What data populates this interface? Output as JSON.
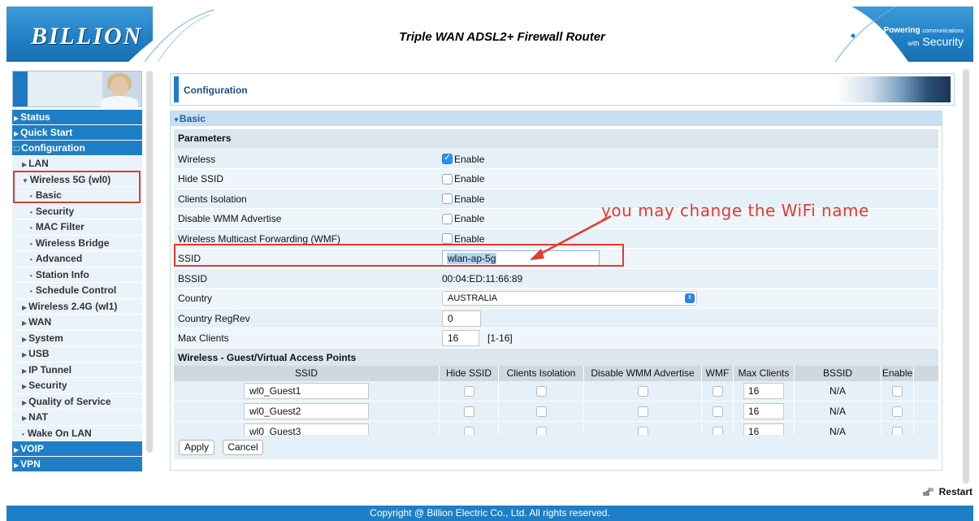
{
  "header": {
    "logo": "BILLION",
    "title": "Triple WAN ADSL2+ Firewall Router",
    "power_line1": "Powering",
    "power_line1_small": "communications",
    "power_line2_small": "with",
    "power_line2": "Security"
  },
  "sidebar": {
    "top_items": [
      {
        "label": "Status"
      },
      {
        "label": "Quick Start"
      },
      {
        "label": "Configuration"
      }
    ],
    "config_items": [
      {
        "label": "LAN"
      },
      {
        "label": "Wireless 5G (wl0)"
      },
      {
        "label": "Basic"
      },
      {
        "label": "Security"
      },
      {
        "label": "MAC Filter"
      },
      {
        "label": "Wireless Bridge"
      },
      {
        "label": "Advanced"
      },
      {
        "label": "Station Info"
      },
      {
        "label": "Schedule Control"
      },
      {
        "label": "Wireless 2.4G (wl1)"
      },
      {
        "label": "WAN"
      },
      {
        "label": "System"
      },
      {
        "label": "USB"
      },
      {
        "label": "IP Tunnel"
      },
      {
        "label": "Security"
      },
      {
        "label": "Quality of Service"
      },
      {
        "label": "NAT"
      },
      {
        "label": "Wake On LAN"
      }
    ],
    "bottom_items": [
      {
        "label": "VOIP"
      },
      {
        "label": "VPN"
      }
    ]
  },
  "main": {
    "page_title": "Configuration",
    "section_title": "Basic",
    "params_header": "Parameters",
    "enable_label": "Enable",
    "rows": {
      "wireless": {
        "label": "Wireless",
        "checked": true
      },
      "hide_ssid": {
        "label": "Hide SSID",
        "checked": false
      },
      "clients_isolation": {
        "label": "Clients Isolation",
        "checked": false
      },
      "disable_wmm": {
        "label": "Disable WMM Advertise",
        "checked": false
      },
      "wmf": {
        "label": "Wireless Multicast Forwarding (WMF)",
        "checked": false
      },
      "ssid": {
        "label": "SSID",
        "value": "wlan-ap-5g"
      },
      "bssid": {
        "label": "BSSID",
        "value": "00:04:ED:11:66:89"
      },
      "country": {
        "label": "Country",
        "value": "AUSTRALIA"
      },
      "country_regrev": {
        "label": "Country RegRev",
        "value": "0"
      },
      "max_clients": {
        "label": "Max Clients",
        "value": "16",
        "hint": "[1-16]"
      }
    },
    "guest_header": "Wireless - Guest/Virtual Access Points",
    "guest_columns": [
      "SSID",
      "Hide SSID",
      "Clients Isolation",
      "Disable WMM Advertise",
      "WMF",
      "Max Clients",
      "BSSID",
      "Enable"
    ],
    "guest_rows": [
      {
        "ssid": "wl0_Guest1",
        "max": "16",
        "bssid": "N/A"
      },
      {
        "ssid": "wl0_Guest2",
        "max": "16",
        "bssid": "N/A"
      },
      {
        "ssid": "wl0_Guest3",
        "max": "16",
        "bssid": "N/A"
      }
    ],
    "apply_label": "Apply",
    "cancel_label": "Cancel"
  },
  "annotation": {
    "text": "you may change the WiFi name"
  },
  "restart_label": "Restart",
  "footer": "Copyright @ Billion Electric Co., Ltd. All rights reserved.",
  "colors": {
    "brand_blue": "#1e7fc7",
    "annotation_red": "#e23b2e"
  }
}
